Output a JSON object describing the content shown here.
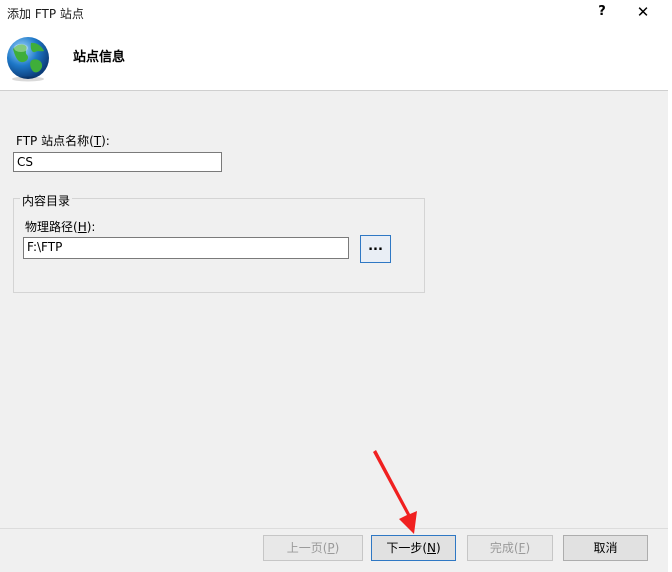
{
  "window": {
    "title": "添加 FTP 站点",
    "help_glyph": "?",
    "close_glyph": "✕"
  },
  "header": {
    "title": "站点信息",
    "icon": "globe-icon"
  },
  "site_name": {
    "label_prefix": "FTP 站点名称(",
    "label_key": "T",
    "label_suffix": "):",
    "value": "CS"
  },
  "content_dir": {
    "group_label": "内容目录",
    "path_label_prefix": "物理路径(",
    "path_label_key": "H",
    "path_label_suffix": "):",
    "path_value": "F:\\FTP",
    "browse_label": "..."
  },
  "footer": {
    "prev": {
      "text": "上一页(",
      "key": "P",
      "end": ")",
      "enabled": false
    },
    "next": {
      "text": "下一步(",
      "key": "N",
      "end": ")",
      "enabled": true
    },
    "finish": {
      "text": "完成(",
      "key": "F",
      "end": ")",
      "enabled": false
    },
    "cancel": {
      "text": "取消"
    }
  },
  "colors": {
    "annotation_arrow": "#f02020",
    "focus_border": "#2f78c4"
  }
}
